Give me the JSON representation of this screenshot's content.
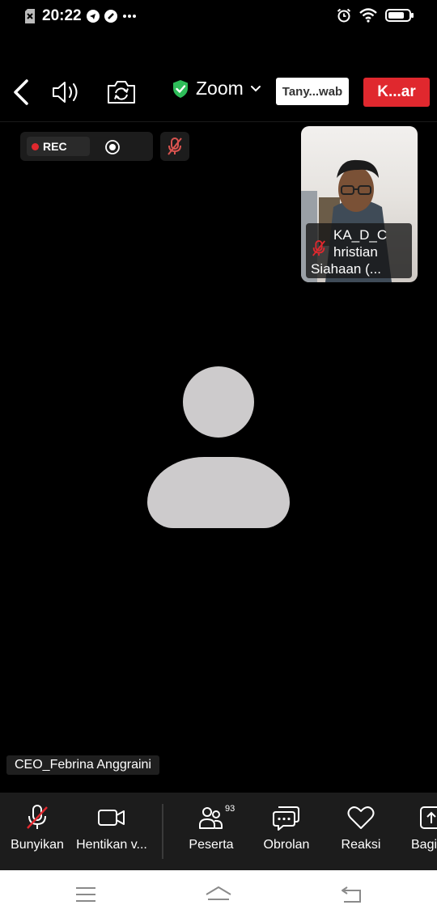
{
  "status_bar": {
    "time": "20:22",
    "icons": [
      "sim-off-icon",
      "telegram-icon",
      "notification-icon",
      "more-dots-icon",
      "alarm-icon",
      "wifi-icon",
      "battery-icon"
    ]
  },
  "top_bar": {
    "back_icon": "back-arrow-icon",
    "speaker_icon": "speaker-icon",
    "switch_camera_icon": "switch-camera-icon",
    "app_title": "Zoom",
    "qa_label": "Tany...wab",
    "leave_label": "K...ar",
    "colors": {
      "leave": "#e0282e",
      "shield": "#2ebd59"
    }
  },
  "recording": {
    "label": "REC"
  },
  "thumbnail": {
    "name_line1": "KA_D_C",
    "name_line2": "hristian",
    "name_line3": "Siahaan (..."
  },
  "active_speaker": {
    "name": "CEO_Febrina Anggraini"
  },
  "toolbar": {
    "items": [
      {
        "label": "Bunyikan",
        "icon": "mic-muted-icon"
      },
      {
        "label": "Hentikan v...",
        "icon": "video-camera-icon"
      },
      {
        "label": "Peserta",
        "icon": "participants-icon",
        "badge": "93"
      },
      {
        "label": "Obrolan",
        "icon": "chat-icon"
      },
      {
        "label": "Reaksi",
        "icon": "heart-icon"
      },
      {
        "label": "Bagi",
        "icon": "share-icon"
      }
    ]
  },
  "nav_bar": {
    "icons": [
      "menu-icon",
      "home-icon",
      "back-icon"
    ]
  }
}
